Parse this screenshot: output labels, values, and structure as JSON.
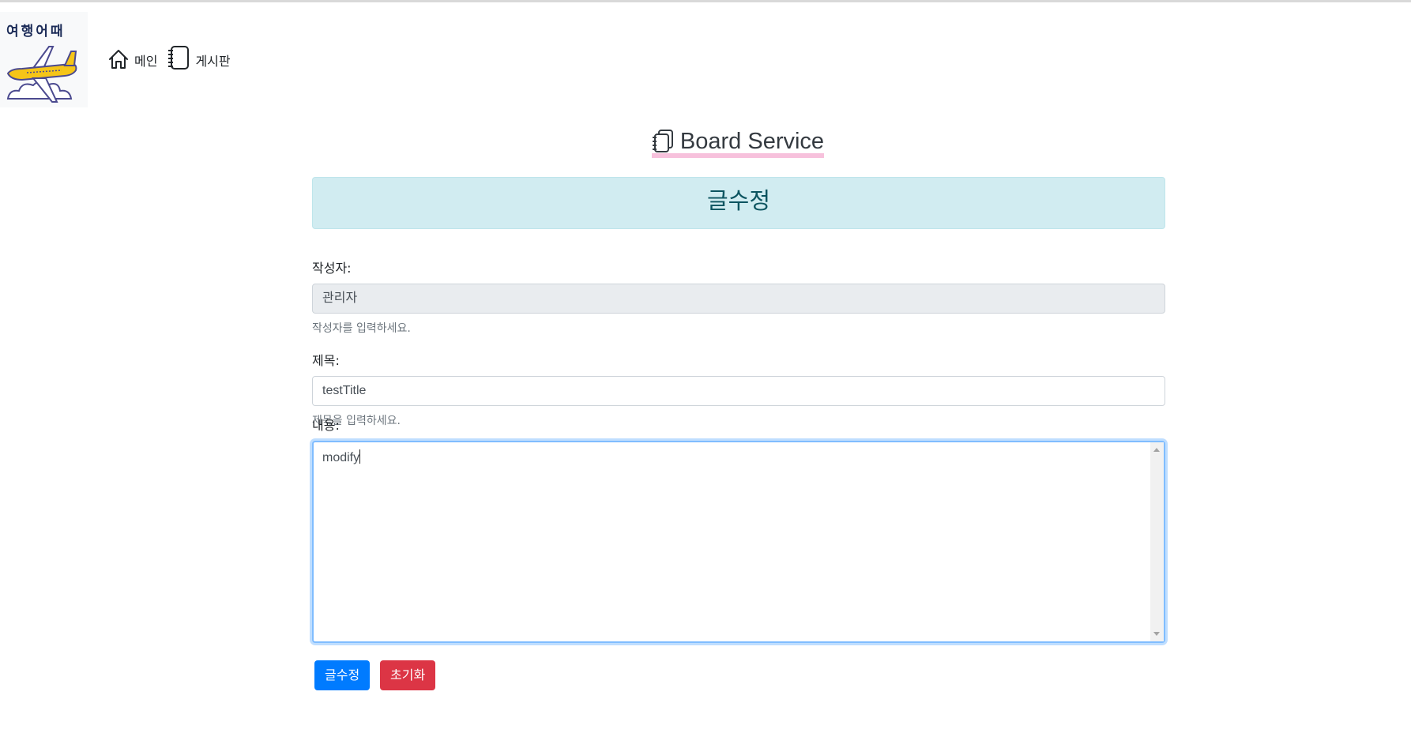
{
  "logo": {
    "text": "여행어때"
  },
  "nav": [
    {
      "label": "메인",
      "icon": "house-icon"
    },
    {
      "label": "게시판",
      "icon": "notebook-icon"
    }
  ],
  "page": {
    "title": "Board Service",
    "title_icon": "notebooks-icon"
  },
  "alert": {
    "text": "글수정",
    "color": "#d1ecf1"
  },
  "form": {
    "writer": {
      "label": "작성자:",
      "value": "관리자",
      "help": "작성자를 입력하세요."
    },
    "title": {
      "label": "제목:",
      "value": "testTitle",
      "help": "제목을 입력하세요."
    },
    "content": {
      "label": "내용:",
      "value": "modify"
    }
  },
  "buttons": {
    "submit": {
      "label": "글수정",
      "color": "#007bff"
    },
    "reset": {
      "label": "초기화",
      "color": "#dc3545"
    }
  }
}
